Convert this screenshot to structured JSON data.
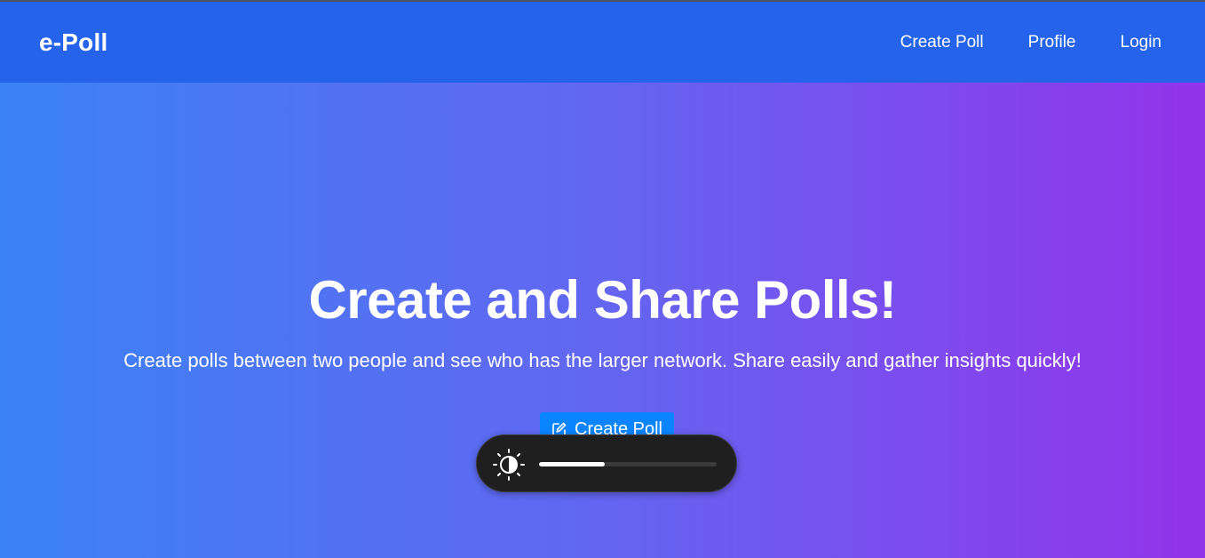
{
  "navbar": {
    "brand": "e-Poll",
    "links": [
      {
        "label": "Create Poll"
      },
      {
        "label": "Profile"
      },
      {
        "label": "Login"
      }
    ]
  },
  "hero": {
    "title": "Create and Share Polls!",
    "subtitle": "Create polls between two people and see who has the larger network. Share easily and gather insights quickly!",
    "cta_label": "Create Poll",
    "cta_icon": "pencil-square-icon"
  },
  "brightness_osd": {
    "icon": "brightness-icon",
    "level": 0.37
  },
  "colors": {
    "navbar": "#2563eb",
    "gradient_start": "#3b82f6",
    "gradient_end": "#9333ea",
    "cta": "#0a84ff"
  }
}
